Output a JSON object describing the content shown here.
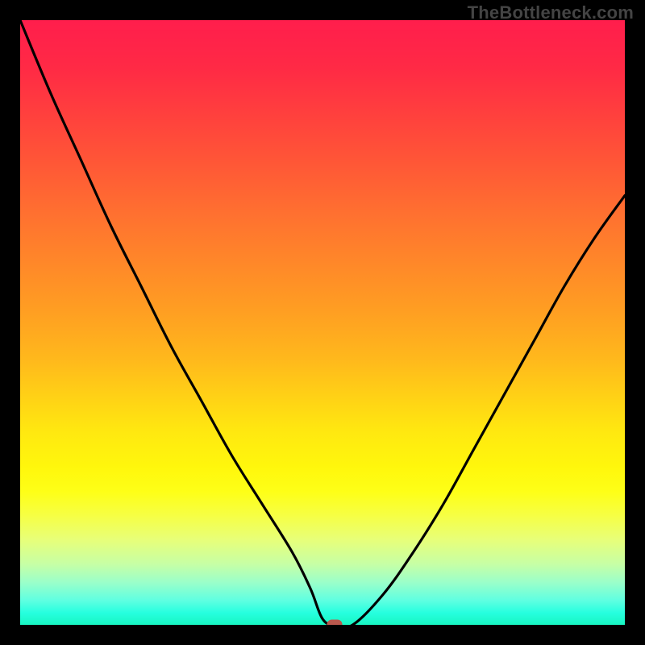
{
  "attribution": "TheBottleneck.com",
  "chart_data": {
    "type": "line",
    "title": "",
    "xlabel": "",
    "ylabel": "",
    "xlim": [
      0,
      100
    ],
    "ylim": [
      0,
      100
    ],
    "series": [
      {
        "name": "bottleneck-curve",
        "x": [
          0,
          5,
          10,
          15,
          20,
          25,
          30,
          35,
          40,
          45,
          48,
          50,
          52,
          55,
          60,
          65,
          70,
          75,
          80,
          85,
          90,
          95,
          100
        ],
        "values": [
          100,
          88,
          77,
          66,
          56,
          46,
          37,
          28,
          20,
          12,
          6,
          1,
          0,
          0,
          5,
          12,
          20,
          29,
          38,
          47,
          56,
          64,
          71
        ]
      }
    ],
    "marker": {
      "x": 52,
      "y": 0,
      "color": "#b9584d"
    },
    "gradient_stops": [
      {
        "pos": 0,
        "color": "#ff1e4c"
      },
      {
        "pos": 0.5,
        "color": "#ffb81c"
      },
      {
        "pos": 0.78,
        "color": "#feff17"
      },
      {
        "pos": 1.0,
        "color": "#18f6c2"
      }
    ],
    "grid": false,
    "legend": false
  }
}
